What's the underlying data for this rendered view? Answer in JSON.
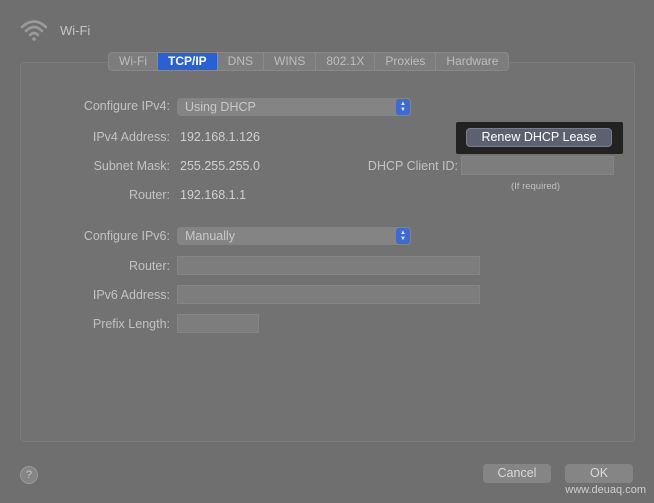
{
  "window": {
    "title": "Wi-Fi"
  },
  "tabs": [
    "Wi-Fi",
    "TCP/IP",
    "DNS",
    "WINS",
    "802.1X",
    "Proxies",
    "Hardware"
  ],
  "active_tab": "TCP/IP",
  "ipv4": {
    "configure_label": "Configure IPv4:",
    "configure_value": "Using DHCP",
    "address_label": "IPv4 Address:",
    "address_value": "192.168.1.126",
    "subnet_label": "Subnet Mask:",
    "subnet_value": "255.255.255.0",
    "router_label": "Router:",
    "router_value": "192.168.1.1",
    "renew_button": "Renew DHCP Lease",
    "dhcp_client_label": "DHCP Client ID:",
    "dhcp_client_hint": "(If required)"
  },
  "ipv6": {
    "configure_label": "Configure IPv6:",
    "configure_value": "Manually",
    "router_label": "Router:",
    "address_label": "IPv6 Address:",
    "prefix_label": "Prefix Length:"
  },
  "footer": {
    "help": "?",
    "cancel": "Cancel",
    "ok": "OK"
  },
  "watermark": "www.deuaq.com"
}
